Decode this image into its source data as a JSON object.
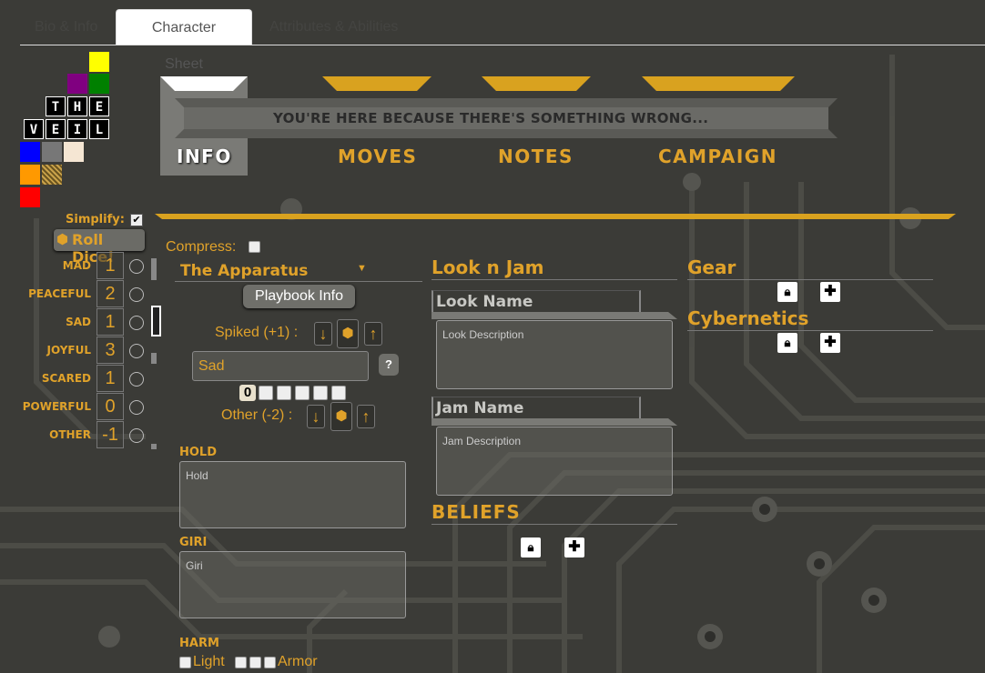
{
  "tabs": [
    {
      "label": "Bio & Info",
      "active": false
    },
    {
      "label": "Character Sheet",
      "active": true
    },
    {
      "label": "Attributes & Abilities",
      "active": false
    }
  ],
  "logo": {
    "letters_row1": [
      "T",
      "H",
      "E"
    ],
    "letters_row2": [
      "V",
      "E",
      "I",
      "L"
    ]
  },
  "nav": {
    "banner": "YOU'RE HERE BECAUSE THERE'S SOMETHING WRONG...",
    "info": "INFO",
    "moves": "MOVES",
    "notes": "NOTES",
    "campaign": "CAMPAIGN"
  },
  "sidebar": {
    "simplify_label": "Simplify:",
    "roll_dice_label": "Roll Dice!",
    "attributes": [
      {
        "name": "MAD",
        "value": "1"
      },
      {
        "name": "PEACEFUL",
        "value": "2"
      },
      {
        "name": "SAD",
        "value": "1"
      },
      {
        "name": "JOYFUL",
        "value": "3"
      },
      {
        "name": "SCARED",
        "value": "1"
      },
      {
        "name": "POWERFUL",
        "value": "0"
      },
      {
        "name": "OTHER",
        "value": "-1"
      }
    ]
  },
  "main": {
    "compress_label": "Compress:",
    "playbook": "The Apparatus",
    "playbook_info_button": "Playbook Info",
    "spiked_label": "Spiked (+1) :",
    "spiked_value": "Sad",
    "spiked_help": "?",
    "counter_value": "0",
    "other_label": "Other (-2) :",
    "hold_title": "HOLD",
    "hold_placeholder": "Hold",
    "giri_title": "GIRI",
    "giri_placeholder": "Giri",
    "harm_title": "HARM",
    "harm_light": "Light",
    "harm_armor": "Armor"
  },
  "look": {
    "title": "Look n Jam",
    "look_name_placeholder": "Look Name",
    "look_description_placeholder": "Look Description",
    "jam_name_placeholder": "Jam Name",
    "jam_description_placeholder": "Jam Description",
    "beliefs_title": "BELIEFS"
  },
  "gear": {
    "title": "Gear",
    "cybernetics_title": "Cybernetics"
  },
  "colors": {
    "accent": "#e0a22a",
    "background": "#3a3a36"
  }
}
